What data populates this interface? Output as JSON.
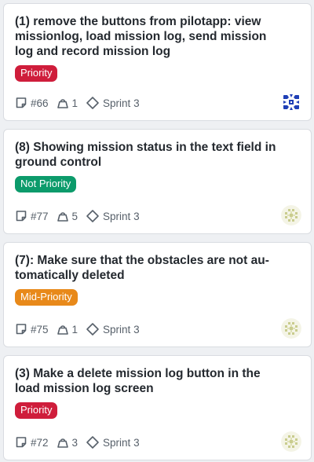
{
  "issues": [
    {
      "title": "(1) remove the buttons from pilotapp: view missionlog, load mission log, send mission log and record mission log",
      "priority": "Priority",
      "priority_color": "#cf1d3b",
      "number": "#66",
      "weight": "1",
      "sprint": "Sprint 3",
      "avatar": "identicon-blue"
    },
    {
      "title": "(8) Showing mission status in the text field in ground control",
      "priority": "Not Priority",
      "priority_color": "#0c9b6b",
      "number": "#77",
      "weight": "5",
      "sprint": "Sprint 3",
      "avatar": "identicon-olive"
    },
    {
      "title": "(7): Make sure that the obstacles are not au-tomatically deleted",
      "priority": "Mid-Priority",
      "priority_color": "#e8891a",
      "number": "#75",
      "weight": "1",
      "sprint": "Sprint 3",
      "avatar": "identicon-olive"
    },
    {
      "title": "(3) Make a delete mission log button in the load mission log screen",
      "priority": "Priority",
      "priority_color": "#cf1d3b",
      "number": "#72",
      "weight": "3",
      "sprint": "Sprint 3",
      "avatar": "identicon-olive"
    }
  ]
}
